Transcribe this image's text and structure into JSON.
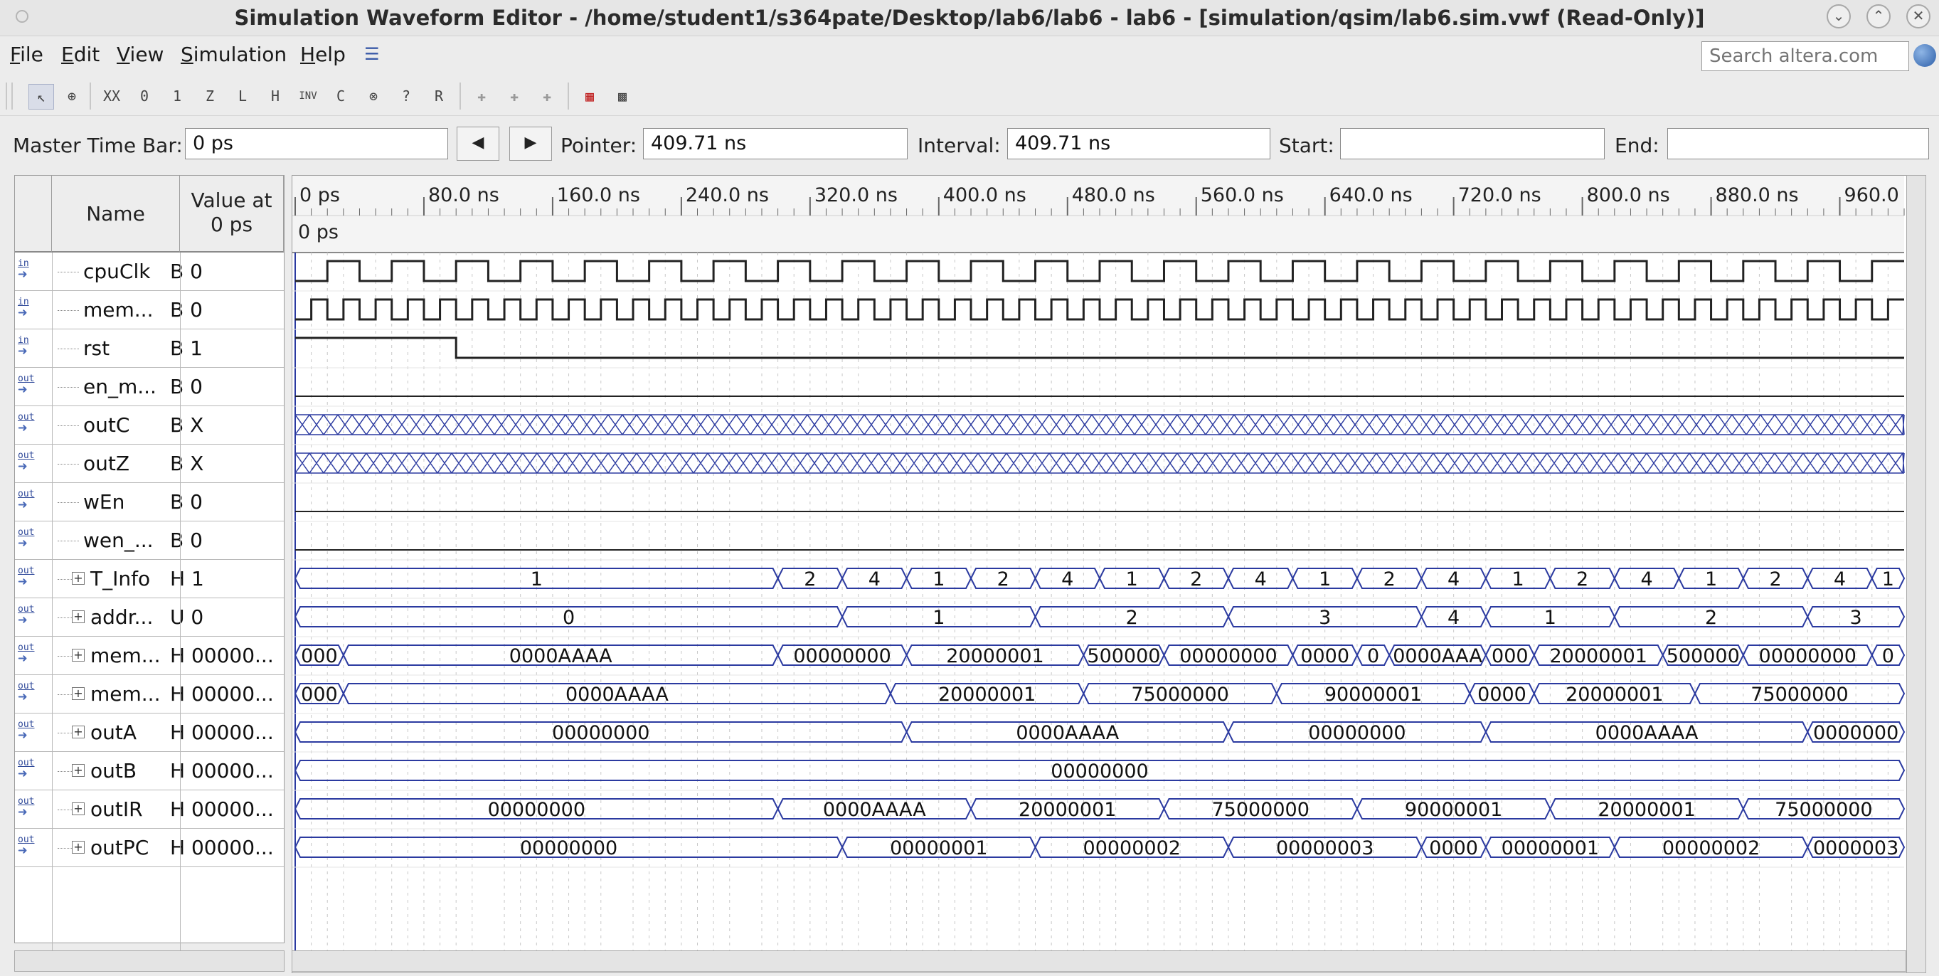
{
  "window": {
    "title": "Simulation Waveform Editor - /home/student1/s364pate/Desktop/lab6/lab6 - lab6 - [simulation/qsim/lab6.sim.vwf (Read-Only)]",
    "controls": [
      "⌄",
      "⌃",
      "✕"
    ]
  },
  "menu": [
    "File",
    "Edit",
    "View",
    "Simulation",
    "Help"
  ],
  "search": {
    "placeholder": "Search altera.com"
  },
  "toolbar": {
    "icons": [
      "grip-icon",
      "select-pointer-icon",
      "zoom-icon",
      "force-unknown-icon",
      "force-low-icon",
      "force-high-icon",
      "force-high-z-icon",
      "force-weak-low-icon",
      "force-weak-high-icon",
      "invert-icon",
      "count-value-icon",
      "clock-icon",
      "arbitrary-value-icon",
      "random-value-icon",
      "snap-icon",
      "run-functional-icon",
      "run-timing-icon",
      "timing-netlist-icon",
      "grid-icon",
      "overwrite-icon"
    ]
  },
  "timebar": {
    "master_label": "Master Time Bar:",
    "master_value": "0 ps",
    "pointer_label": "Pointer:",
    "pointer_value": "409.71 ns",
    "interval_label": "Interval:",
    "interval_value": "409.71 ns",
    "start_label": "Start:",
    "start_value": "",
    "end_label": "End:",
    "end_value": "",
    "prev_symbol": "◀",
    "next_symbol": "▶"
  },
  "table": {
    "name_header": "Name",
    "value_header": "Value at\n0 ps",
    "signals": [
      {
        "dir": "in",
        "name": "cpuClk",
        "value": "B 0",
        "bus": false
      },
      {
        "dir": "in",
        "name": "mem...",
        "value": "B 0",
        "bus": false
      },
      {
        "dir": "in",
        "name": "rst",
        "value": "B 1",
        "bus": false
      },
      {
        "dir": "out",
        "name": "en_m...",
        "value": "B 0",
        "bus": false
      },
      {
        "dir": "out",
        "name": "outC",
        "value": "B X",
        "bus": false
      },
      {
        "dir": "out",
        "name": "outZ",
        "value": "B X",
        "bus": false
      },
      {
        "dir": "out",
        "name": "wEn",
        "value": "B 0",
        "bus": false
      },
      {
        "dir": "out",
        "name": "wen_...",
        "value": "B 0",
        "bus": false
      },
      {
        "dir": "out",
        "name": "T_Info",
        "value": "H 1",
        "bus": true
      },
      {
        "dir": "out",
        "name": "addr...",
        "value": "U 0",
        "bus": true
      },
      {
        "dir": "out",
        "name": "mem...",
        "value": "H 00000...",
        "bus": true
      },
      {
        "dir": "out",
        "name": "mem...",
        "value": "H 00000...",
        "bus": true
      },
      {
        "dir": "out",
        "name": "outA",
        "value": "H 00000...",
        "bus": true
      },
      {
        "dir": "out",
        "name": "outB",
        "value": "H 00000...",
        "bus": true
      },
      {
        "dir": "out",
        "name": "outIR",
        "value": "H 00000...",
        "bus": true
      },
      {
        "dir": "out",
        "name": "outPC",
        "value": "H 00000...",
        "bus": true
      }
    ]
  },
  "ruler": {
    "ticks": [
      "0 ps",
      "80.0 ns",
      "160.0 ns",
      "240.0 ns",
      "320.0 ns",
      "400.0 ns",
      "480.0 ns",
      "560.0 ns",
      "640.0 ns",
      "720.0 ns",
      "800.0 ns",
      "880.0 ns",
      "960.0 ns"
    ],
    "cursor_label": "0 ps",
    "tick_spacing_ns": 80,
    "visible_span_ns": 1000
  },
  "waves": [
    {
      "type": "clock",
      "period_ns": 40,
      "start_level": 0
    },
    {
      "type": "clock",
      "period_ns": 20,
      "start_level": 0
    },
    {
      "type": "step",
      "high_until_ns": 100,
      "start_level": 1
    },
    {
      "type": "const",
      "level": 0
    },
    {
      "type": "unknown"
    },
    {
      "type": "unknown"
    },
    {
      "type": "const",
      "level": 0
    },
    {
      "type": "const",
      "level": 0
    },
    {
      "type": "bus",
      "segs": [
        [
          0,
          300,
          "1"
        ],
        [
          300,
          340,
          "2"
        ],
        [
          340,
          380,
          "4"
        ],
        [
          380,
          420,
          "1"
        ],
        [
          420,
          460,
          "2"
        ],
        [
          460,
          500,
          "4"
        ],
        [
          500,
          540,
          "1"
        ],
        [
          540,
          580,
          "2"
        ],
        [
          580,
          620,
          "4"
        ],
        [
          620,
          660,
          "1"
        ],
        [
          660,
          700,
          "2"
        ],
        [
          700,
          740,
          "4"
        ],
        [
          740,
          780,
          "1"
        ],
        [
          780,
          820,
          "2"
        ],
        [
          820,
          860,
          "4"
        ],
        [
          860,
          900,
          "1"
        ],
        [
          900,
          940,
          "2"
        ],
        [
          940,
          980,
          "4"
        ],
        [
          980,
          1000,
          "1"
        ]
      ]
    },
    {
      "type": "bus",
      "segs": [
        [
          0,
          340,
          "0"
        ],
        [
          340,
          460,
          "1"
        ],
        [
          460,
          580,
          "2"
        ],
        [
          580,
          700,
          "3"
        ],
        [
          700,
          740,
          "4"
        ],
        [
          740,
          820,
          "1"
        ],
        [
          820,
          940,
          "2"
        ],
        [
          940,
          1000,
          "3"
        ]
      ]
    },
    {
      "type": "bus",
      "segs": [
        [
          0,
          30,
          "0000"
        ],
        [
          30,
          300,
          "0000AAAA"
        ],
        [
          300,
          380,
          "00000000"
        ],
        [
          380,
          490,
          "20000001"
        ],
        [
          490,
          540,
          "500000"
        ],
        [
          540,
          620,
          "00000000"
        ],
        [
          620,
          660,
          "0000"
        ],
        [
          660,
          680,
          "00"
        ],
        [
          680,
          740,
          "0000AAA"
        ],
        [
          740,
          770,
          "000"
        ],
        [
          770,
          850,
          "20000001"
        ],
        [
          850,
          900,
          "500000"
        ],
        [
          900,
          980,
          "00000000"
        ],
        [
          980,
          1000,
          "00"
        ]
      ]
    },
    {
      "type": "bus",
      "segs": [
        [
          0,
          30,
          "000"
        ],
        [
          30,
          370,
          "0000AAAA"
        ],
        [
          370,
          490,
          "20000001"
        ],
        [
          490,
          610,
          "75000000"
        ],
        [
          610,
          730,
          "90000001"
        ],
        [
          730,
          770,
          "0000"
        ],
        [
          770,
          870,
          "20000001"
        ],
        [
          870,
          1000,
          "75000000"
        ]
      ]
    },
    {
      "type": "bus",
      "segs": [
        [
          0,
          380,
          "00000000"
        ],
        [
          380,
          580,
          "0000AAAA"
        ],
        [
          580,
          740,
          "00000000"
        ],
        [
          740,
          940,
          "0000AAAA"
        ],
        [
          940,
          1000,
          "0000000"
        ]
      ]
    },
    {
      "type": "bus",
      "segs": [
        [
          0,
          1000,
          "00000000"
        ]
      ]
    },
    {
      "type": "bus",
      "segs": [
        [
          0,
          300,
          "00000000"
        ],
        [
          300,
          420,
          "0000AAAA"
        ],
        [
          420,
          540,
          "20000001"
        ],
        [
          540,
          660,
          "75000000"
        ],
        [
          660,
          780,
          "90000001"
        ],
        [
          780,
          900,
          "20000001"
        ],
        [
          900,
          1000,
          "75000000"
        ]
      ]
    },
    {
      "type": "bus",
      "segs": [
        [
          0,
          340,
          "00000000"
        ],
        [
          340,
          460,
          "00000001"
        ],
        [
          460,
          580,
          "00000002"
        ],
        [
          580,
          700,
          "00000003"
        ],
        [
          700,
          740,
          "0000"
        ],
        [
          740,
          820,
          "00000001"
        ],
        [
          820,
          940,
          "00000002"
        ],
        [
          940,
          1000,
          "0000003"
        ]
      ]
    }
  ],
  "colors": {
    "wave": "#222222",
    "bus": "#2b3aa0",
    "grid": "#c8c8c8",
    "cursor": "#2b3aa0"
  }
}
